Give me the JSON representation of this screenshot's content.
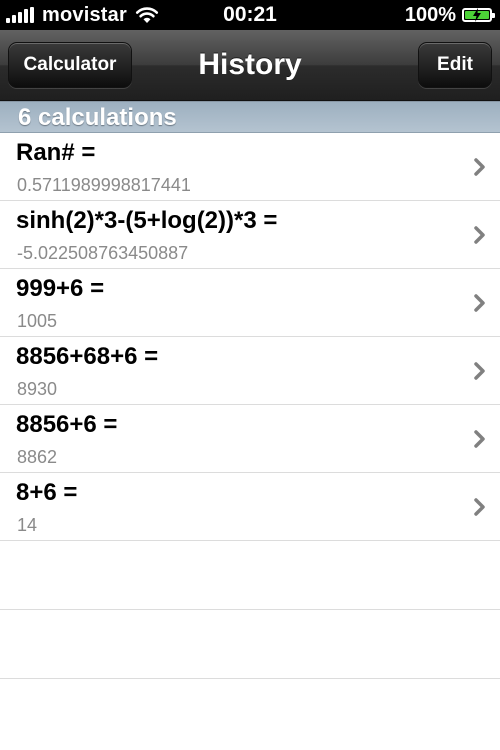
{
  "status_bar": {
    "carrier": "movistar",
    "time": "00:21",
    "battery_percent": "100%",
    "battery_level": 1.0,
    "icons": [
      "signal-bars-icon",
      "wifi-icon",
      "battery-charging-icon"
    ]
  },
  "nav": {
    "back_label": "Calculator",
    "title": "History",
    "edit_label": "Edit"
  },
  "section": {
    "header": "6 calculations"
  },
  "history": [
    {
      "expression": "Ran# =",
      "result": "0.5711989998817441"
    },
    {
      "expression": "sinh(2)*3-(5+log(2))*3 =",
      "result": "-5.022508763450887"
    },
    {
      "expression": "999+6 =",
      "result": "1005"
    },
    {
      "expression": "8856+68+6 =",
      "result": "8930"
    },
    {
      "expression": "8856+6 =",
      "result": "8862"
    },
    {
      "expression": "8+6 =",
      "result": "14"
    }
  ],
  "colors": {
    "section_header": "#a7b8c6",
    "result_text": "#8a8a8a",
    "chevron": "#808080",
    "battery_fill": "#4cd137"
  }
}
